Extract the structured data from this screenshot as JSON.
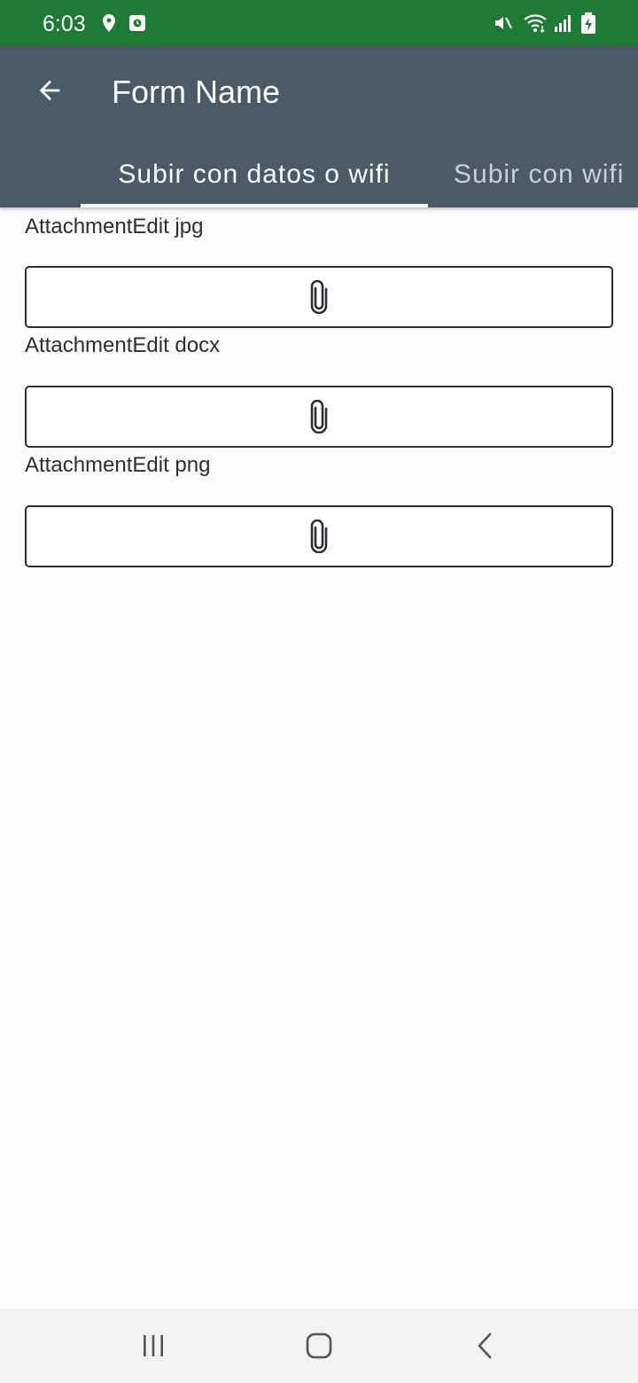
{
  "status_bar": {
    "time": "6:03",
    "icons": [
      "location-icon",
      "screen-record-icon",
      "mute-icon",
      "wifi-icon",
      "signal-icon",
      "battery-charging-icon"
    ],
    "background_color": "#1f7a36"
  },
  "app_bar": {
    "title": "Form Name",
    "back_icon": "arrow-back-icon",
    "background_color": "#4a5b67"
  },
  "tabs": [
    {
      "label": "Subir con datos o wifi",
      "selected": true
    },
    {
      "label": "Subir con wifi",
      "selected": false
    }
  ],
  "form": {
    "fields": [
      {
        "label": "AttachmentEdit jpg",
        "icon": "paperclip-icon"
      },
      {
        "label": "AttachmentEdit docx",
        "icon": "paperclip-icon"
      },
      {
        "label": "AttachmentEdit png",
        "icon": "paperclip-icon"
      }
    ]
  },
  "nav_bar": {
    "buttons": [
      "recent-apps-icon",
      "home-icon",
      "back-icon"
    ]
  }
}
